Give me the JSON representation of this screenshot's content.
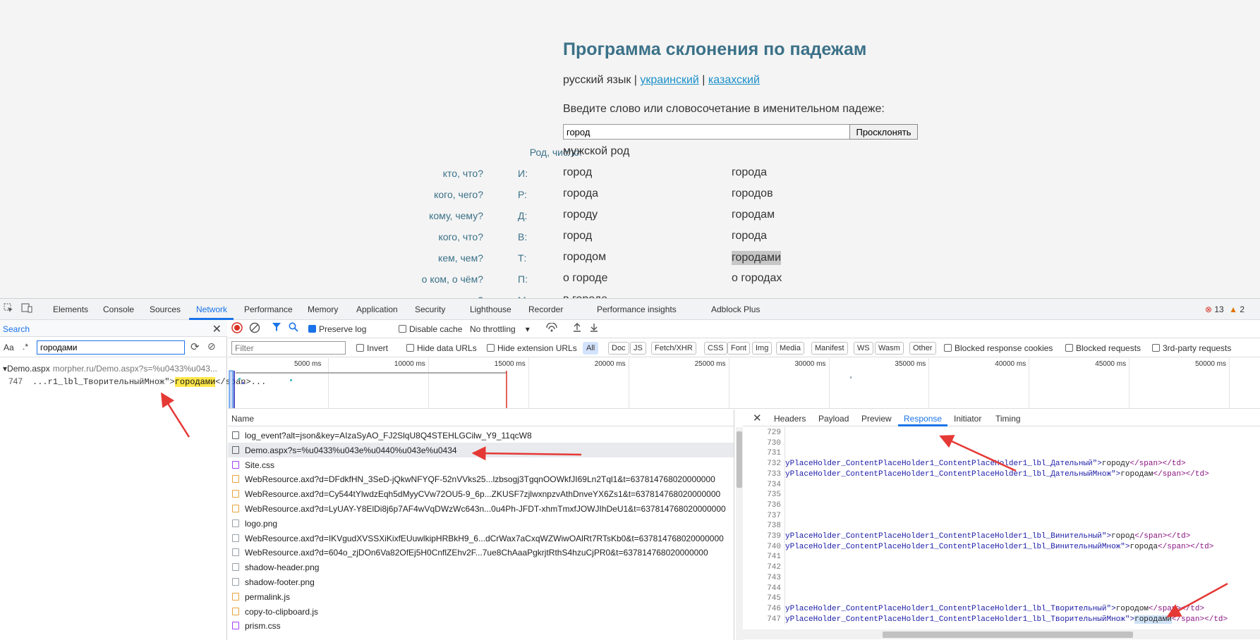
{
  "page": {
    "title": "Программа склонения по падежам",
    "lang_current": "русский язык",
    "lang_sep": " | ",
    "lang_links": [
      "украинский",
      "казахский"
    ],
    "prompt": "Введите слово или словосочетание в именительном падеже:",
    "input_value": "город",
    "button": "Просклонять",
    "gender_label": "Род, число:",
    "gender_value": "мужской род",
    "cases": [
      {
        "q": "кто, что?",
        "c": "И:",
        "s": "город",
        "p": "города"
      },
      {
        "q": "кого, чего?",
        "c": "Р:",
        "s": "города",
        "p": "городов"
      },
      {
        "q": "кому, чему?",
        "c": "Д:",
        "s": "городу",
        "p": "городам"
      },
      {
        "q": "кого, что?",
        "c": "В:",
        "s": "город",
        "p": "города"
      },
      {
        "q": "кем, чем?",
        "c": "Т:",
        "s": "городом",
        "p": "городами"
      },
      {
        "q": "о ком, о чём?",
        "c": "П:",
        "s": "о городе",
        "p": "о городах"
      },
      {
        "q": "где?",
        "c": "М:",
        "s": "в городе",
        "p": ""
      }
    ]
  },
  "devtools": {
    "tabs": [
      "Elements",
      "Console",
      "Sources",
      "Network",
      "Performance",
      "Memory",
      "Application",
      "Security",
      "Lighthouse",
      "Recorder",
      "Performance insights",
      "Adblock Plus"
    ],
    "active_tab": "Network",
    "errors": "13",
    "warnings": "2",
    "search": {
      "title": "Search",
      "aa": "Aa",
      "regex": ".*",
      "query": "городами",
      "result_file": "Demo.aspx",
      "result_path": "morpher.ru/Demo.aspx?s=%u0433%u043...",
      "result_line_no": "747",
      "result_pre": "...r1_lbl_ТворительныйМнож\">",
      "result_match": "городами",
      "result_post": "</span>..."
    },
    "toolbar": {
      "preserve_log": "Preserve log",
      "disable_cache": "Disable cache",
      "throttling": "No throttling"
    },
    "filter": {
      "placeholder": "Filter",
      "invert": "Invert",
      "hide_data_urls": "Hide data URLs",
      "hide_ext_urls": "Hide extension URLs",
      "types": [
        "All",
        "Doc",
        "JS",
        "Fetch/XHR",
        "CSS",
        "Font",
        "Img",
        "Media",
        "Manifest",
        "WS",
        "Wasm",
        "Other"
      ],
      "blocked_cookies": "Blocked response cookies",
      "blocked_requests": "Blocked requests",
      "third_party": "3rd-party requests"
    },
    "timeline_ticks": [
      "5000 ms",
      "10000 ms",
      "15000 ms",
      "20000 ms",
      "25000 ms",
      "30000 ms",
      "35000 ms",
      "40000 ms",
      "45000 ms",
      "50000 ms"
    ],
    "list_header": "Name",
    "requests": [
      {
        "name": "log_event?alt=json&key=AIzaSyAO_FJ2SlqU8Q4STEHLGCilw_Y9_11qcW8",
        "kind": "doc"
      },
      {
        "name": "Demo.aspx?s=%u0433%u043e%u0440%u043e%u0434",
        "kind": "doc",
        "selected": true
      },
      {
        "name": "Site.css",
        "kind": "css"
      },
      {
        "name": "WebResource.axd?d=DFdkfHN_3SeD-jQkwNFYQF-52nVVks25...lzbsogj3TgqnOOWkfJI69Ln2Tql1&t=637814768020000000",
        "kind": "js"
      },
      {
        "name": "WebResource.axd?d=Cy544tYlwdzEqh5dMyyCVw72OU5-9_6p...ZKUSF7zjlwxnpzvAthDnveYX6Zs1&t=637814768020000000",
        "kind": "js"
      },
      {
        "name": "WebResource.axd?d=LyUAY-Y8ElDi8j6p7AF4wVqDWzWc643n...0u4Ph-JFDT-xhmTmxfJOWJIhDeU1&t=637814768020000000",
        "kind": "js"
      },
      {
        "name": "logo.png",
        "kind": "img"
      },
      {
        "name": "WebResource.axd?d=IKVgudXVSSXiKixfEUuwlkipHRBkH9_6...dCrWax7aCxqWZWiwOAlRt7RTsKb0&t=637814768020000000",
        "kind": "img"
      },
      {
        "name": "WebResource.axd?d=604o_zjDOn6Va82OfEj5H0CnflZEhv2F...7ue8ChAaaPgkrjtRthS4hzuCjPR0&t=637814768020000000",
        "kind": "img"
      },
      {
        "name": "shadow-header.png",
        "kind": "img"
      },
      {
        "name": "shadow-footer.png",
        "kind": "img"
      },
      {
        "name": "permalink.js",
        "kind": "js"
      },
      {
        "name": "copy-to-clipboard.js",
        "kind": "js"
      },
      {
        "name": "prism.css",
        "kind": "css"
      }
    ],
    "detail_tabs": [
      "Headers",
      "Payload",
      "Preview",
      "Response",
      "Initiator",
      "Timing"
    ],
    "detail_active": "Response",
    "code_lines": [
      {
        "n": "729",
        "code": ""
      },
      {
        "n": "730",
        "code": ""
      },
      {
        "n": "731",
        "code": ""
      },
      {
        "n": "732",
        "pre": "yPlaceHolder_ContentPlaceHolder1_ContentPlaceHolder1_lbl_Дательный\">",
        "word": "городу",
        "post": "</span></td>"
      },
      {
        "n": "733",
        "pre": "yPlaceHolder_ContentPlaceHolder1_ContentPlaceHolder1_lbl_ДательныйМнож\">",
        "word": "городам",
        "post": "</span></td>"
      },
      {
        "n": "734",
        "code": ""
      },
      {
        "n": "735",
        "code": ""
      },
      {
        "n": "736",
        "code": ""
      },
      {
        "n": "737",
        "code": ""
      },
      {
        "n": "738",
        "code": ""
      },
      {
        "n": "739",
        "pre": "yPlaceHolder_ContentPlaceHolder1_ContentPlaceHolder1_lbl_Винительный\">",
        "word": "город",
        "post": "</span></td>"
      },
      {
        "n": "740",
        "pre": "yPlaceHolder_ContentPlaceHolder1_ContentPlaceHolder1_lbl_ВинительныйМнож\">",
        "word": "города",
        "post": "</span></td>"
      },
      {
        "n": "741",
        "code": ""
      },
      {
        "n": "742",
        "code": ""
      },
      {
        "n": "743",
        "code": ""
      },
      {
        "n": "744",
        "code": ""
      },
      {
        "n": "745",
        "code": ""
      },
      {
        "n": "746",
        "pre": "yPlaceHolder_ContentPlaceHolder1_ContentPlaceHolder1_lbl_Творительный\">",
        "word": "городом",
        "post": "</span></td>"
      },
      {
        "n": "747",
        "pre": "yPlaceHolder_ContentPlaceHolder1_ContentPlaceHolder1_lbl_ТворительныйМнож\">",
        "word": "городами",
        "post": "</span></td>",
        "selected": true
      }
    ],
    "colors": {
      "accent": "#1a73e8",
      "error": "#d93025",
      "warning": "#e37400",
      "annotation": "#e53935"
    }
  }
}
